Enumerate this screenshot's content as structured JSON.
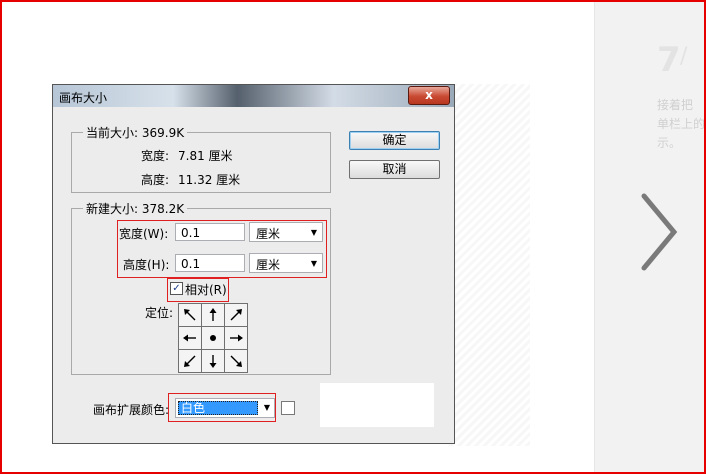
{
  "dialog": {
    "title": "画布大小",
    "close_glyph": "x",
    "current_size": {
      "label": "当前大小: 369.9K",
      "width_label": "宽度:",
      "width_value": "7.81 厘米",
      "height_label": "高度:",
      "height_value": "11.32 厘米"
    },
    "new_size": {
      "label": "新建大小: 378.2K",
      "width_label": "宽度(W):",
      "width_value": "0.1",
      "width_unit": "厘米",
      "height_label": "高度(H):",
      "height_value": "0.1",
      "height_unit": "厘米",
      "relative_label": "相对(R)",
      "relative_checked": true,
      "anchor_label": "定位:"
    },
    "extension_color": {
      "label": "画布扩展颜色:",
      "value": "白色",
      "swatch_color": "#ffffff"
    },
    "ok_label": "确定",
    "cancel_label": "取消"
  },
  "side_panel": {
    "step_number": "7",
    "step_slash": "/",
    "lines": [
      "接着把",
      "单栏上的",
      "示。"
    ]
  },
  "colors": {
    "highlight": "#e02020",
    "selection": "#3399ff"
  }
}
